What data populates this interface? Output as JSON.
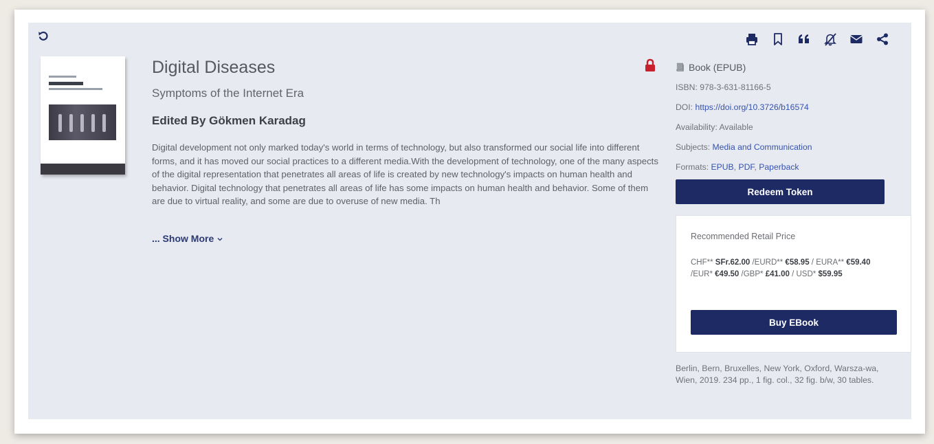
{
  "book": {
    "title": "Digital Diseases",
    "subtitle": "Symptoms of the Internet Era",
    "editors": "Edited By Gökmen Karadag",
    "abstract": "Digital development not only marked today's world in terms of technology, but also transformed our social life into different forms, and it has moved our social practices to a different media.With the development of technology, one of the many aspects of the digital representation that penetrates all areas of life is created by new technology's impacts on human health and behavior. Digital technology that penetrates all areas of life has some impacts on human health and behavior. Some of them are due to virtual reality, and some are due to overuse of new media. Th",
    "show_more": "... Show More"
  },
  "meta": {
    "type": "Book (EPUB)",
    "isbn": "ISBN: 978-3-631-81166-5",
    "doi_label": "DOI: ",
    "doi_link": "https://doi.org/10.3726/b16574",
    "availability": "Availability: Available",
    "subjects_label": "Subjects: ",
    "subjects_link": "Media and Communication",
    "formats_label": "Formats: ",
    "format_epub": "EPUB",
    "format_pdf": "PDF",
    "format_paperback": "Paperback",
    "sep": ", "
  },
  "actions": {
    "redeem_label": "Redeem Token",
    "buy_label": "Buy EBook"
  },
  "price": {
    "heading": "Recommended Retail Price",
    "chf_label": "CHF** ",
    "chf_value": "SFr.62.00",
    "eurd_label": " /EURD** ",
    "eurd_value": "€58.95",
    "eura_label": " / EURA** ",
    "eura_value": "€59.40",
    "eur_label": " /EUR* ",
    "eur_value": "€49.50",
    "gbp_label": " /GBP* ",
    "gbp_value": "£41.00",
    "usd_label": " / USD* ",
    "usd_value": "$59.95"
  },
  "pubinfo": "Berlin, Bern, Bruxelles, New York, Oxford, Warsza-wa, Wien, 2019. 234 pp., 1 fig. col., 32 fig. b/w, 30 tables.",
  "icons": [
    "back-icon",
    "print-icon",
    "bookmark-icon",
    "quote-icon",
    "no-alert-icon",
    "email-icon",
    "share-icon",
    "lock-icon"
  ],
  "colors": {
    "accent": "#1d2a64",
    "link": "#3553b0",
    "lock": "#c8202f",
    "panel": "#e7eaf0"
  }
}
